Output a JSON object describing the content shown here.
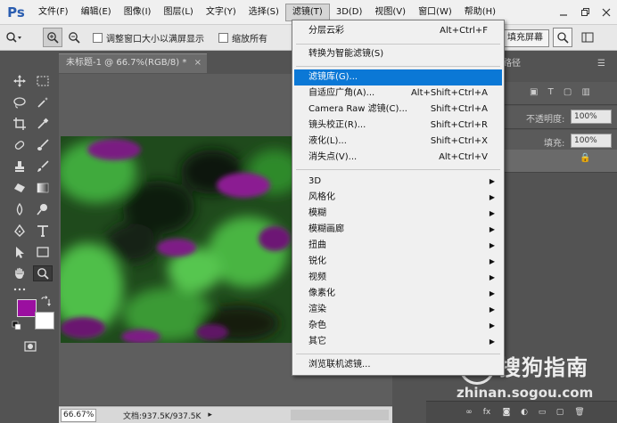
{
  "app": {
    "logo": "Ps",
    "menus": [
      "文件(F)",
      "编辑(E)",
      "图像(I)",
      "图层(L)",
      "文字(Y)",
      "选择(S)",
      "滤镜(T)",
      "3D(D)",
      "视图(V)",
      "窗口(W)",
      "帮助(H)"
    ],
    "active_menu_index": 6
  },
  "options": {
    "resize_windows": "调整窗口大小以满屏显示",
    "zoom_all": "缩放所有",
    "fill_screen": "填充屏幕"
  },
  "document": {
    "tab_title": "未标题-1 @ 66.7%(RGB/8) *",
    "zoom": "66.67%",
    "doc_size": "文档:937.5K/937.5K"
  },
  "panels": {
    "tab_fragment": "路径",
    "opacity_label": "不透明度:",
    "opacity_value": "100%",
    "fill_label": "填充:",
    "fill_value": "100%"
  },
  "filter_menu": {
    "last_filter": {
      "label": "分层云彩",
      "shortcut": "Alt+Ctrl+F"
    },
    "convert_smart": {
      "label": "转换为智能滤镜(S)"
    },
    "gallery": {
      "label": "滤镜库(G)..."
    },
    "adaptive_wide": {
      "label": "自适应广角(A)...",
      "shortcut": "Alt+Shift+Ctrl+A"
    },
    "camera_raw": {
      "label": "Camera Raw 滤镜(C)...",
      "shortcut": "Shift+Ctrl+A"
    },
    "lens_correction": {
      "label": "镜头校正(R)...",
      "shortcut": "Shift+Ctrl+R"
    },
    "liquify": {
      "label": "液化(L)...",
      "shortcut": "Shift+Ctrl+X"
    },
    "vanishing_point": {
      "label": "消失点(V)...",
      "shortcut": "Alt+Ctrl+V"
    },
    "submenus": [
      "3D",
      "风格化",
      "模糊",
      "模糊画廊",
      "扭曲",
      "锐化",
      "视频",
      "像素化",
      "渲染",
      "杂色",
      "其它"
    ],
    "browse_online": {
      "label": "浏览联机滤镜..."
    }
  },
  "watermark": {
    "brand": "搜狗指南",
    "url": "zhinan.sogou.com"
  },
  "colors": {
    "foreground": "#9b0fa0",
    "background": "#ffffff",
    "highlight": "#0b78d6"
  }
}
